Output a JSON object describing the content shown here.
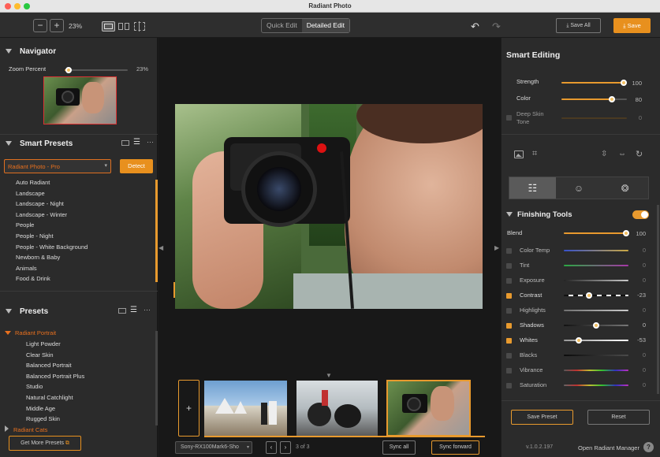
{
  "window": {
    "title": "Radiant Photo"
  },
  "toolbar": {
    "zoom_out": "−",
    "zoom_in": "+",
    "zoom_level": "23%",
    "mode_quick": "Quick Edit",
    "mode_detailed": "Detailed Edit",
    "save_all": "Save All",
    "save": "Save"
  },
  "navigator": {
    "title": "Navigator",
    "zoom_label": "Zoom Percent",
    "zoom_value": "23%",
    "zoom_level": 0.23
  },
  "smart_presets": {
    "title": "Smart Presets",
    "selected": "Radiant Photo - Pro",
    "detect": "Detect",
    "items": [
      "Auto Radiant",
      "Landscape",
      "Landscape - Night",
      "Landscape - Winter",
      "People",
      "People - Night",
      "People - White Background",
      "Newborn & Baby",
      "Animals",
      "Food & Drink"
    ]
  },
  "presets": {
    "title": "Presets",
    "group1": "Radiant Portrait",
    "group1_items": [
      "Light Powder",
      "Clear Skin",
      "Balanced Portrait",
      "Balanced Portrait Plus",
      "Studio",
      "Natural Catchlight",
      "Middle Age",
      "Rugged Skin"
    ],
    "group2": "Radiant Cats",
    "get_more": "Get More Presets"
  },
  "filmstrip": {
    "add": "+",
    "camera": "Sony-RX100Mark6-Sho",
    "counter": "3 of 3",
    "sync_all": "Sync all",
    "sync_forward": "Sync forward"
  },
  "smart_editing": {
    "title": "Smart Editing",
    "strength_label": "Strength",
    "strength_value": "100",
    "color_label": "Color",
    "color_value": "80",
    "deep_label": "Deep Skin Tone",
    "deep_value": "0"
  },
  "finishing": {
    "title": "Finishing Tools",
    "blend_label": "Blend",
    "blend_value": "100",
    "tools": [
      {
        "label": "Color Temp",
        "value": "0",
        "checked": false
      },
      {
        "label": "Tint",
        "value": "0",
        "checked": false
      },
      {
        "label": "Exposure",
        "value": "0",
        "checked": false
      },
      {
        "label": "Contrast",
        "value": "-23",
        "checked": true
      },
      {
        "label": "Highlights",
        "value": "0",
        "checked": false
      },
      {
        "label": "Shadows",
        "value": "0",
        "checked": true
      },
      {
        "label": "Whites",
        "value": "-53",
        "checked": true
      },
      {
        "label": "Blacks",
        "value": "0",
        "checked": false
      },
      {
        "label": "Vibrance",
        "value": "0",
        "checked": false
      },
      {
        "label": "Saturation",
        "value": "0",
        "checked": false
      }
    ],
    "save_preset": "Save Preset",
    "reset": "Reset"
  },
  "footer": {
    "version": "v.1.0.2.197",
    "manager": "Open Radiant Manager",
    "help": "?"
  },
  "colors": {
    "accent": "#e89a2e",
    "panel": "#2b2b2b",
    "canvas": "#181818"
  }
}
